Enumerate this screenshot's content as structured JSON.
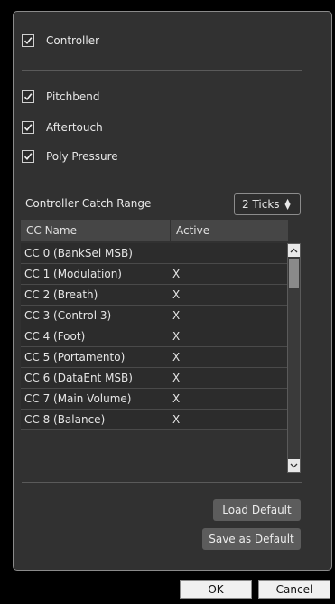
{
  "controller": {
    "label": "Controller",
    "checked": true
  },
  "filters": [
    {
      "label": "Pitchbend",
      "checked": true
    },
    {
      "label": "Aftertouch",
      "checked": true
    },
    {
      "label": "Poly Pressure",
      "checked": true
    }
  ],
  "catch_range": {
    "label": "Controller Catch Range",
    "value": "2 Ticks"
  },
  "table": {
    "headers": {
      "name": "CC Name",
      "active": "Active"
    },
    "rows": [
      {
        "name": "CC 0  (BankSel MSB)",
        "active": ""
      },
      {
        "name": "CC 1  (Modulation)",
        "active": "X"
      },
      {
        "name": "CC 2  (Breath)",
        "active": "X"
      },
      {
        "name": "CC 3  (Control 3)",
        "active": "X"
      },
      {
        "name": "CC 4  (Foot)",
        "active": "X"
      },
      {
        "name": "CC 5  (Portamento)",
        "active": "X"
      },
      {
        "name": "CC 6  (DataEnt MSB)",
        "active": "X"
      },
      {
        "name": "CC 7  (Main Volume)",
        "active": "X"
      },
      {
        "name": "CC 8  (Balance)",
        "active": "X"
      }
    ]
  },
  "buttons": {
    "load_default": "Load Default",
    "save_default": "Save as Default",
    "ok": "OK",
    "cancel": "Cancel"
  }
}
